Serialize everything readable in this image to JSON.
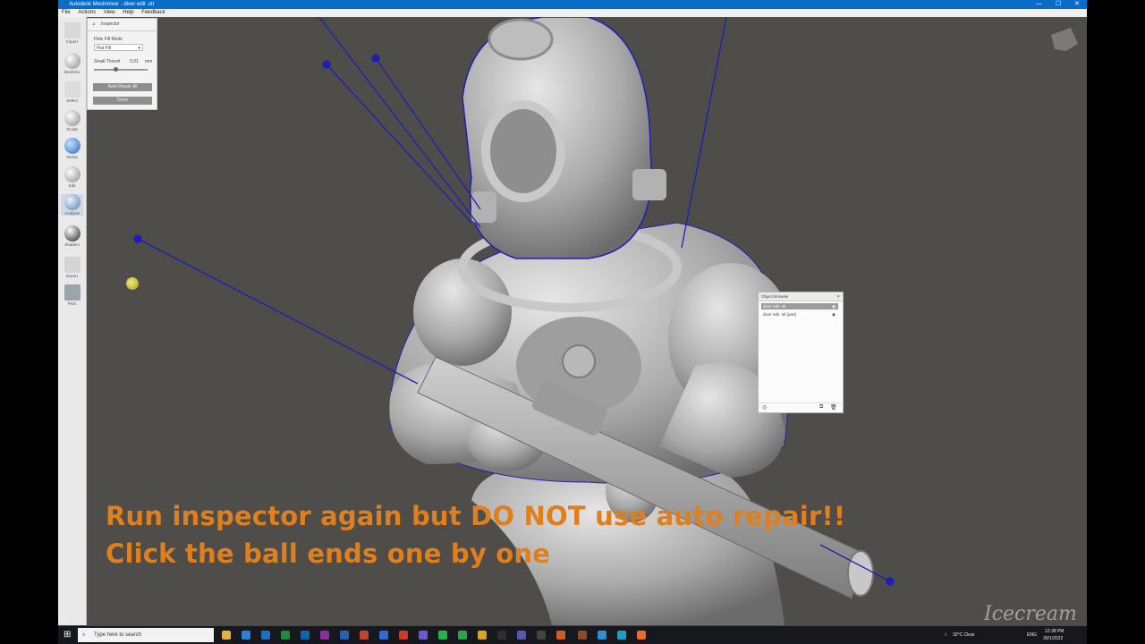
{
  "window": {
    "title": "Autodesk Meshmixer - diver edit .stl",
    "controls": [
      "—",
      "☐",
      "✕"
    ]
  },
  "menu": [
    "File",
    "Actions",
    "View",
    "Help",
    "Feedback"
  ],
  "toolbar": [
    {
      "label": "Import",
      "icon": "plus-icon"
    },
    {
      "label": "Meshmix",
      "icon": "meshmix-icon"
    },
    {
      "label": "Select",
      "icon": "select-arrow-icon"
    },
    {
      "label": "Sculpt",
      "icon": "sculpt-brush-icon"
    },
    {
      "label": "Stamp",
      "icon": "stamp-icon"
    },
    {
      "label": "Edit",
      "icon": "edit-icon"
    },
    {
      "label": "Analysis",
      "icon": "analysis-icon"
    },
    {
      "label": "Shaders",
      "icon": "shaders-icon"
    },
    {
      "label": "Export",
      "icon": "export-icon"
    },
    {
      "label": "Print",
      "icon": "print-icon"
    }
  ],
  "inspector": {
    "title": "Inspector",
    "hole_fill_label": "Hole Fill Mode",
    "hole_fill_value": "Flat Fill",
    "small_thresh_label": "Small Thresh",
    "small_thresh_value": "0.01",
    "small_thresh_unit": "mm",
    "small_thresh_slider": 0.4,
    "auto_repair_label": "Auto Repair All",
    "done_label": "Done"
  },
  "object_browser": {
    "title": "Object Browser",
    "items": [
      {
        "name": "diver edit .stl",
        "selected": true
      },
      {
        "name": "diver edit .stl (part)",
        "selected": false
      }
    ]
  },
  "caption": {
    "line1": "Run inspector again but DO NOT use auto repair!!",
    "line2": "Click the ball ends one by one"
  },
  "watermark": "Icecream",
  "taskbar": {
    "search_placeholder": "Type here to search",
    "weather": "32°C  Clear",
    "language": "ENG",
    "time": "12:38 PM",
    "date": "30/1/2022"
  },
  "colors": {
    "accent": "#e07f1d",
    "title_bar": "#0a6cc9",
    "viewport": "#4f4d49",
    "marker_line": "#1f1fb5"
  }
}
